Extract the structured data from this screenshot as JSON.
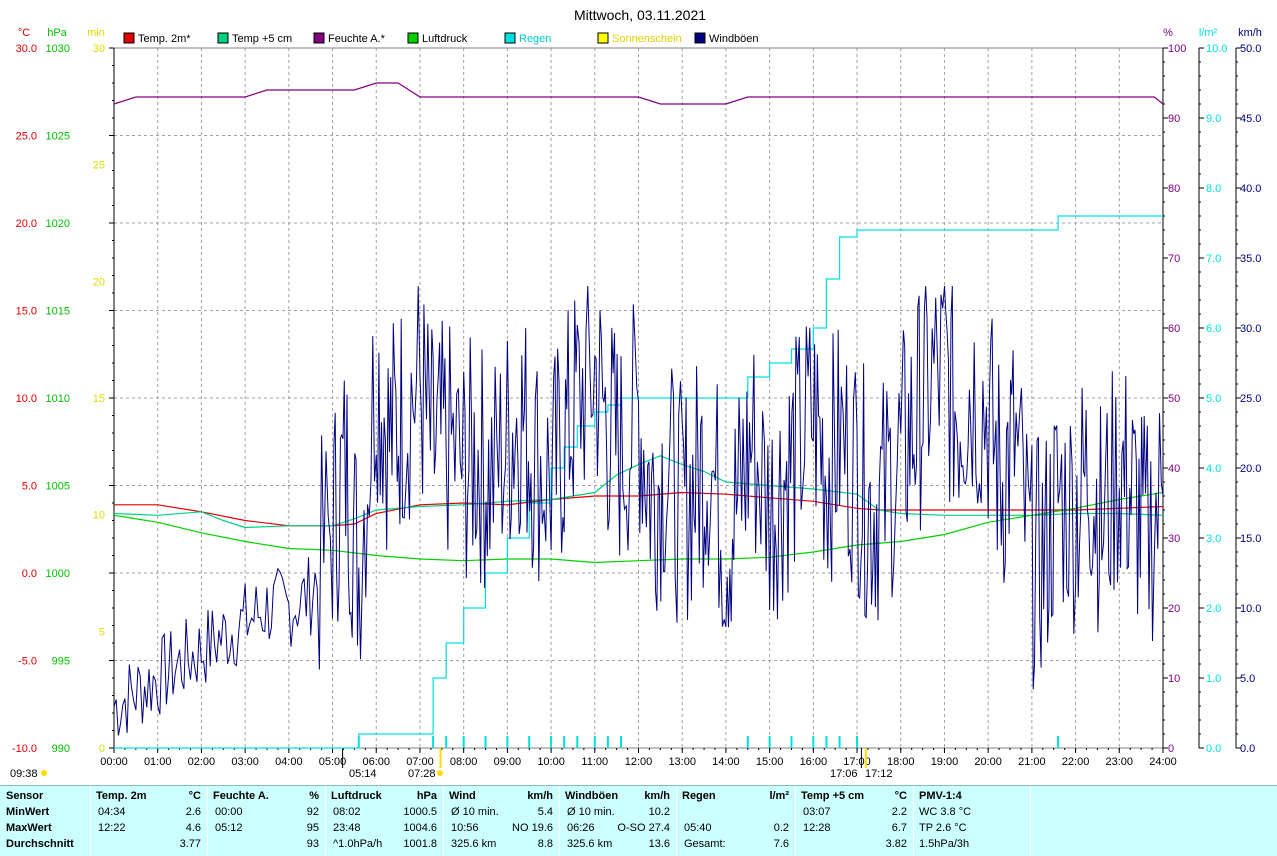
{
  "chart_data": {
    "type": "line",
    "title": "Mittwoch, 03.11.2021",
    "legend": [
      {
        "name": "Temp. 2m*",
        "color": "#e00000"
      },
      {
        "name": "Temp +5 cm",
        "color": "#00d080"
      },
      {
        "name": "Feuchte A.*",
        "color": "#800080"
      },
      {
        "name": "Luftdruck",
        "color": "#00d000"
      },
      {
        "name": "Regen",
        "color": "#00e0e0"
      },
      {
        "name": "Sonnenschein",
        "color": "#ffff00"
      },
      {
        "name": "Windböen",
        "color": "#000080"
      }
    ],
    "axes": {
      "left": [
        {
          "unit": "°C",
          "color": "#e00000",
          "ticks": [
            "30.0",
            "25.0",
            "20.0",
            "15.0",
            "10.0",
            "5.0",
            "0.0",
            "-5.0",
            "-10.0"
          ],
          "range": [
            -10,
            30
          ]
        },
        {
          "unit": "hPa",
          "color": "#00c000",
          "ticks": [
            "1030",
            "1025",
            "1020",
            "1015",
            "1010",
            "1005",
            "1000",
            "995",
            "990"
          ],
          "range": [
            990,
            1030
          ]
        },
        {
          "unit": "min",
          "color": "#dddd00",
          "ticks": [
            "30",
            "25",
            "20",
            "15",
            "10",
            "5",
            "0"
          ],
          "range": [
            0,
            30
          ]
        }
      ],
      "right": [
        {
          "unit": "%",
          "color": "#800080",
          "ticks": [
            "100",
            "90",
            "80",
            "70",
            "60",
            "50",
            "40",
            "30",
            "20",
            "10",
            "0"
          ],
          "range": [
            0,
            100
          ]
        },
        {
          "unit": "l/m²",
          "color": "#00e0e0",
          "ticks": [
            "10.0",
            "9.0",
            "8.0",
            "7.0",
            "6.0",
            "5.0",
            "4.0",
            "3.0",
            "2.0",
            "1.0",
            "0.0"
          ],
          "range": [
            0,
            10
          ]
        },
        {
          "unit": "km/h",
          "color": "#000080",
          "ticks": [
            "50.0",
            "45.0",
            "40.0",
            "35.0",
            "30.0",
            "25.0",
            "20.0",
            "15.0",
            "10.0",
            "5.0",
            "0.0"
          ],
          "range": [
            0,
            50
          ]
        }
      ]
    },
    "x_ticks": [
      "00:00",
      "01:00",
      "02:00",
      "03:00",
      "04:00",
      "05:00",
      "06:00",
      "07:00",
      "08:00",
      "09:00",
      "10:00",
      "11:00",
      "12:00",
      "13:00",
      "14:00",
      "15:00",
      "16:00",
      "17:00",
      "18:00",
      "19:00",
      "20:00",
      "21:00",
      "22:00",
      "23:00",
      "24:00"
    ],
    "grid": true,
    "markers": {
      "left_time": "09:38",
      "sunrise": "05:14",
      "sunrise2": "07:28",
      "sunset": "17:06",
      "sunset2": "17:12"
    },
    "series": [
      {
        "name": "Temp. 2m*",
        "axis": "temp",
        "color": "#e00000",
        "x": [
          0,
          1,
          2,
          3,
          4,
          5,
          5.5,
          6,
          7,
          8,
          9,
          10,
          11,
          12,
          13,
          14,
          15,
          16,
          17,
          17.5,
          18,
          19,
          20,
          21,
          22,
          23,
          24
        ],
        "y": [
          3.9,
          3.9,
          3.5,
          3.0,
          2.7,
          2.7,
          2.8,
          3.4,
          3.9,
          4.0,
          3.9,
          4.2,
          4.4,
          4.4,
          4.6,
          4.5,
          4.3,
          4.1,
          3.7,
          3.6,
          3.6,
          3.6,
          3.6,
          3.6,
          3.6,
          3.7,
          3.8
        ]
      },
      {
        "name": "Temp +5 cm",
        "axis": "temp",
        "color": "#00d080",
        "x": [
          0,
          1,
          2,
          2.5,
          3,
          4,
          5,
          5.5,
          6,
          7,
          8,
          9,
          10,
          11,
          11.5,
          12,
          12.5,
          13,
          13.5,
          14,
          15,
          16,
          17,
          17.5,
          18,
          19,
          20,
          21,
          22,
          23,
          24
        ],
        "y": [
          3.4,
          3.3,
          3.5,
          3.0,
          2.6,
          2.7,
          2.7,
          3.1,
          3.6,
          3.8,
          3.9,
          4.1,
          4.2,
          4.6,
          5.6,
          6.2,
          6.7,
          6.2,
          5.8,
          5.2,
          5.0,
          4.8,
          4.5,
          3.6,
          3.4,
          3.3,
          3.3,
          3.3,
          3.4,
          3.4,
          3.3
        ]
      },
      {
        "name": "Feuchte A.*",
        "axis": "hum",
        "color": "#800080",
        "x": [
          0,
          0.5,
          1,
          2,
          3,
          3.5,
          4,
          5,
          5.5,
          6,
          6.5,
          7,
          8,
          9,
          10,
          11,
          12,
          12.5,
          13,
          14,
          14.5,
          15,
          16,
          17,
          18,
          19,
          20,
          21,
          22,
          23,
          23.8,
          24
        ],
        "y": [
          92,
          93,
          93,
          93,
          93,
          94,
          94,
          94,
          94,
          95,
          95,
          93,
          93,
          93,
          93,
          93,
          93,
          92,
          92,
          92,
          93,
          93,
          93,
          93,
          93,
          93,
          93,
          93,
          93,
          93,
          93,
          92
        ]
      },
      {
        "name": "Luftdruck",
        "axis": "press",
        "color": "#00d000",
        "x": [
          0,
          1,
          2,
          3,
          4,
          5,
          6,
          7,
          8,
          9,
          10,
          11,
          12,
          13,
          14,
          15,
          16,
          17,
          18,
          19,
          20,
          21,
          22,
          23,
          24
        ],
        "y": [
          1003.3,
          1002.9,
          1002.3,
          1001.8,
          1001.4,
          1001.3,
          1001.0,
          1000.8,
          1000.7,
          1000.8,
          1000.8,
          1000.6,
          1000.7,
          1000.8,
          1000.8,
          1000.9,
          1001.2,
          1001.6,
          1001.8,
          1002.2,
          1002.9,
          1003.3,
          1003.7,
          1004.2,
          1004.6
        ]
      },
      {
        "name": "Regen",
        "axis": "rain",
        "color": "#00e0e0",
        "x": [
          0,
          5.6,
          7.0,
          7.3,
          7.6,
          8.0,
          8.5,
          9.0,
          9.5,
          10.0,
          10.3,
          10.6,
          11.0,
          11.3,
          11.6,
          12.0,
          12.5,
          13.0,
          14.0,
          14.5,
          15.0,
          15.5,
          16.0,
          16.3,
          16.6,
          17.0,
          18.0,
          19.0,
          20.0,
          21.0,
          21.6,
          22.0,
          23.0,
          24.0
        ],
        "y": [
          0,
          0.2,
          0.2,
          1.0,
          1.5,
          2.0,
          2.5,
          3.0,
          3.5,
          4.0,
          4.3,
          4.6,
          4.8,
          4.9,
          5.0,
          5.0,
          5.0,
          5.0,
          5.0,
          5.3,
          5.5,
          5.7,
          6.0,
          6.7,
          7.3,
          7.4,
          7.4,
          7.4,
          7.4,
          7.4,
          7.6,
          7.6,
          7.6,
          7.6
        ]
      },
      {
        "name": "Windböen",
        "axis": "wind",
        "color": "#000080",
        "x": [
          0,
          0.5,
          1,
          1.5,
          2,
          2.5,
          3,
          3.5,
          4,
          4.5,
          5,
          5.3,
          5.6,
          6.0,
          6.3,
          6.6,
          7.0,
          7.3,
          7.6,
          8.0,
          8.3,
          8.6,
          9.0,
          9.3,
          9.6,
          10.0,
          10.3,
          10.6,
          11.0,
          11.3,
          11.6,
          12.0,
          12.3,
          12.6,
          13.0,
          13.3,
          13.6,
          14.0,
          14.3,
          14.6,
          15.0,
          15.3,
          15.6,
          16.0,
          16.3,
          16.6,
          17.0,
          17.3,
          17.6,
          18.0,
          18.3,
          18.6,
          19.0,
          19.3,
          19.6,
          20.0,
          20.3,
          20.6,
          21.0,
          21.3,
          21.6,
          22.0,
          22.3,
          22.6,
          23.0,
          23.3,
          23.6,
          24.0
        ],
        "y": [
          3,
          4,
          5,
          6,
          7,
          8,
          9,
          10,
          10,
          11,
          16,
          20,
          13,
          27,
          22,
          24,
          26,
          21,
          22,
          20,
          21,
          19,
          22,
          24,
          21,
          19,
          22,
          25,
          27,
          23,
          21,
          24,
          18,
          20,
          17,
          19,
          21,
          15,
          18,
          22,
          17,
          19,
          21,
          24,
          20,
          22,
          20,
          17,
          18,
          21,
          23,
          26,
          27,
          24,
          26,
          24,
          19,
          22,
          13,
          14,
          18,
          17,
          20,
          16,
          20,
          18,
          15,
          18
        ]
      }
    ]
  },
  "table": {
    "columns": [
      {
        "header": "Sensor",
        "unit": "",
        "rows": [
          "MinWert",
          "MaxWert",
          "Durchschnitt"
        ]
      },
      {
        "header": "Temp. 2m",
        "unit": "°C",
        "times": [
          "04:34",
          "12:22",
          ""
        ],
        "values": [
          "2.6",
          "4.6",
          "3.77"
        ]
      },
      {
        "header": "Feuchte A.",
        "unit": "%",
        "times": [
          "00:00",
          "05:12",
          ""
        ],
        "values": [
          "92",
          "95",
          "93"
        ]
      },
      {
        "header": "Luftdruck",
        "unit": "hPa",
        "times": [
          "08:02",
          "23:48",
          "^1.0hPa/h"
        ],
        "values": [
          "1000.5",
          "1004.6",
          "1001.8"
        ]
      },
      {
        "header": "Wind",
        "unit": "km/h",
        "times": [
          "Ø 10 min.",
          "10:56",
          "325.6 km"
        ],
        "values": [
          "5.4",
          "NO 19.6",
          "8.8"
        ]
      },
      {
        "header": "Windböen",
        "unit": "km/h",
        "times": [
          "Ø 10 min.",
          "06:26",
          "325.6 km"
        ],
        "values": [
          "10.2",
          "O-SO 27.4",
          "13.6"
        ]
      },
      {
        "header": "Regen",
        "unit": "l/m²",
        "times": [
          "",
          "05:40",
          "Gesamt:"
        ],
        "values": [
          "",
          "0.2",
          "7.6"
        ]
      },
      {
        "header": "Temp +5 cm",
        "unit": "°C",
        "times": [
          "03:07",
          "12:28",
          ""
        ],
        "values": [
          "2.2",
          "6.7",
          "3.82"
        ]
      },
      {
        "header": "PMV-1:4",
        "unit": "",
        "rows": [
          "WC 3.8 °C",
          "TP 2.6 °C",
          "1.5hPa/3h"
        ]
      }
    ]
  }
}
